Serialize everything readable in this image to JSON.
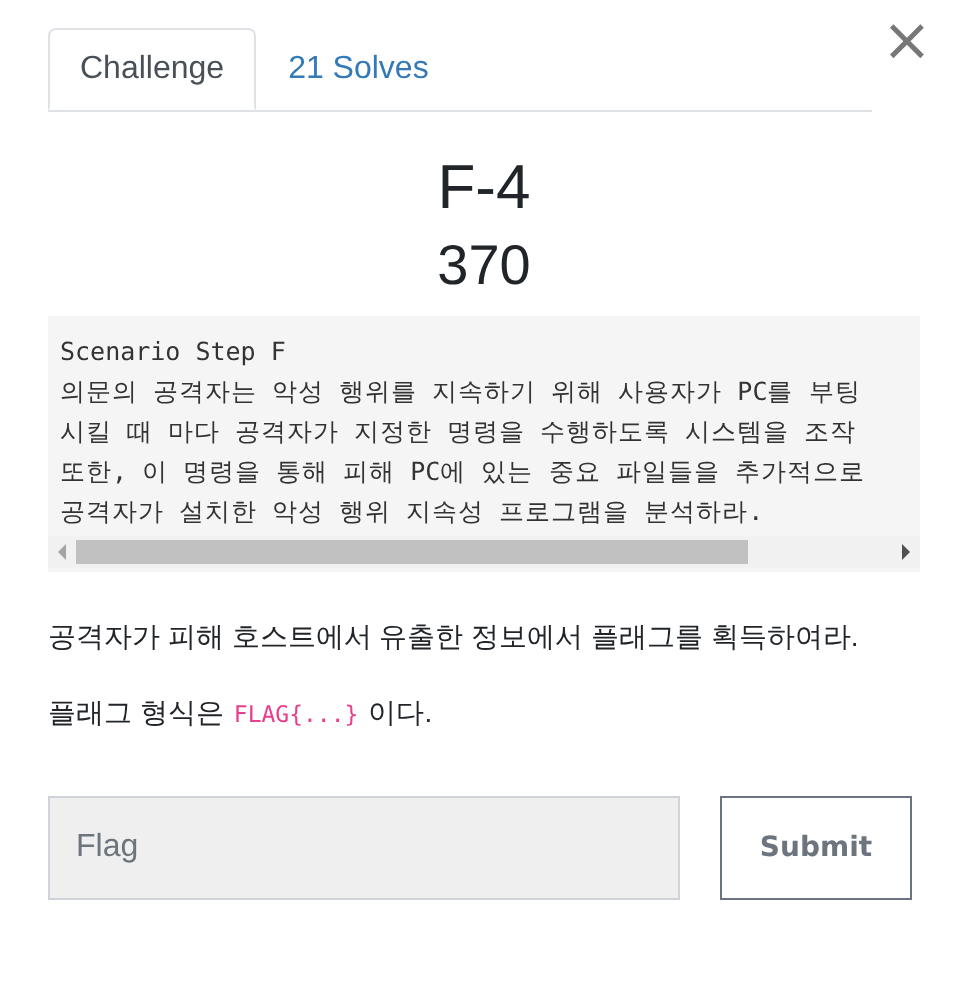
{
  "tabs": [
    {
      "label": "Challenge",
      "selected": true
    },
    {
      "label": "21 Solves",
      "selected": false
    }
  ],
  "close": {
    "glyph": "×"
  },
  "challenge": {
    "name": "F-4",
    "points": "370"
  },
  "code_block": {
    "lines": [
      "Scenario Step F",
      "의문의 공격자는 악성 행위를 지속하기 위해 사용자가 PC를 부팅",
      "시킬 때 마다 공격자가 지정한 명령을 수행하도록 시스템을 조작",
      "또한, 이 명령을 통해 피해 PC에 있는 중요 파일들을 추가적으로",
      "공격자가 설치한 악성 행위 지속성 프로그램을 분석하라."
    ]
  },
  "paragraphs": [
    {
      "text": "공격자가 피해 호스트에서 유출한 정보에서 플래그를 획득하여라."
    },
    {
      "before": "플래그 형식은",
      "code": "FLAG{...}",
      "after": "이다."
    }
  ],
  "form": {
    "placeholder": "Flag",
    "button": "Submit"
  }
}
